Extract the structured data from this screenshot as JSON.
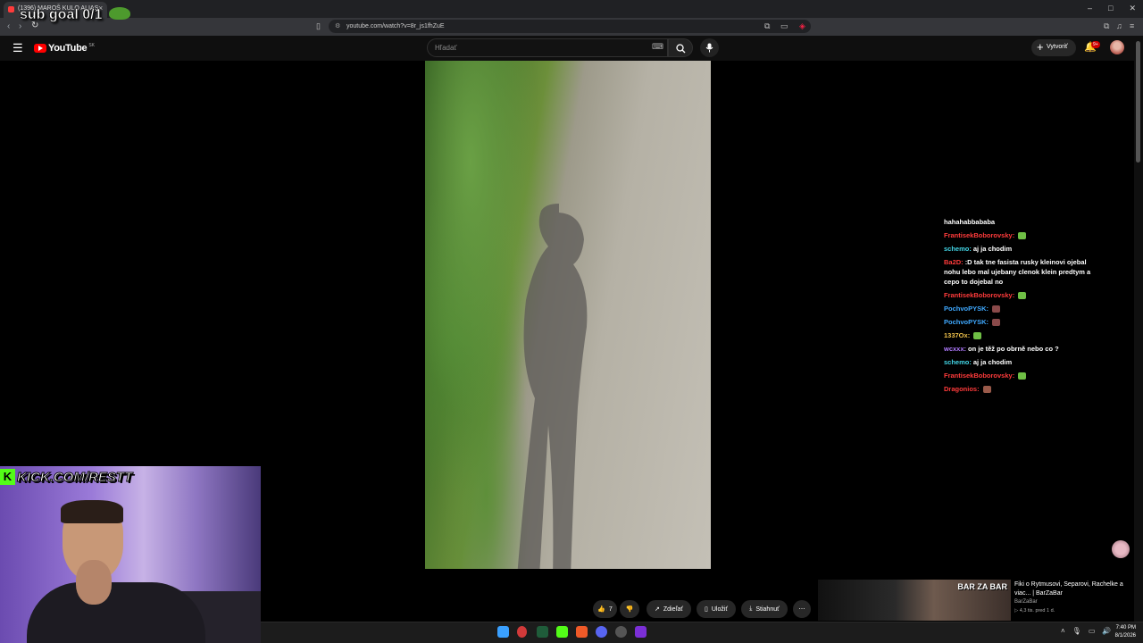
{
  "overlay": {
    "sub_goal": "sub goal 0/1"
  },
  "browser": {
    "tab_title": "(1396) MAROŠ KULO ALIAS",
    "tab_close": "×",
    "url": "youtube.com/watch?v=8r_js1fhZuE",
    "window_controls": [
      "–",
      "□",
      "✕"
    ]
  },
  "youtube": {
    "logo_text": "YouTube",
    "logo_region": "SK",
    "search_placeholder": "Hľadať",
    "create_label": "Vytvoriť",
    "notification_badge": "9+"
  },
  "chat": {
    "messages": [
      {
        "user": "hahahabbababa",
        "user_color": "#ffffff",
        "text": "",
        "emote": ""
      },
      {
        "user": "FrantisekBoborovsky:",
        "user_color": "#ff3b3b",
        "text": "",
        "emote": "#6fbf45"
      },
      {
        "user": "schemo:",
        "user_color": "#43d6e6",
        "text": "aj ja chodim",
        "emote": ""
      },
      {
        "user": "Ba2D:",
        "user_color": "#ff3b3b",
        "text": ":D tak tne fasista rusky kleinovi ojebal nohu lebo mal ujebany clenok klein predtym a cepo to dojebal no",
        "emote": ""
      },
      {
        "user": "FrantisekBoborovsky:",
        "user_color": "#ff3b3b",
        "text": "",
        "emote": "#6fbf45"
      },
      {
        "user": "PochvoPYSK:",
        "user_color": "#3fa9ff",
        "text": "",
        "emote": "#8a4a4a"
      },
      {
        "user": "PochvoPYSK:",
        "user_color": "#3fa9ff",
        "text": "",
        "emote": "#8a4a4a"
      },
      {
        "user": "1337Ox:",
        "user_color": "#f0c24b",
        "text": "",
        "emote": "#6fbf45"
      },
      {
        "user": "wcxxx:",
        "user_color": "#b07bff",
        "text": "on je těž po obrně nebo co ?",
        "emote": ""
      },
      {
        "user": "schemo:",
        "user_color": "#43d6e6",
        "text": "aj ja chodim",
        "emote": ""
      },
      {
        "user": "FrantisekBoborovsky:",
        "user_color": "#ff3b3b",
        "text": "",
        "emote": "#6fbf45"
      },
      {
        "user": "Dragonios:",
        "user_color": "#ff3b3b",
        "text": "",
        "emote": "#9a5a4a"
      }
    ]
  },
  "webcam": {
    "kick_text": "KICK.COM/RESTT",
    "kick_letter": "K"
  },
  "actions": {
    "like_count": "7",
    "share_label": "Zdieľať",
    "save_label": "Uložiť",
    "download_label": "Stiahnuť",
    "more_label": "⋯"
  },
  "recommended": {
    "title": "Fiki o Rytmusovi, Separovi, Rachelke a viac... | BarZaBar",
    "channel": "BarZaBar",
    "meta": "▷ 4,3 tis.   pred 1 d.",
    "thumb_logo": "BAR ZA BAR"
  },
  "taskbar": {
    "time": "7:40 PM",
    "date": "8/1/2026"
  },
  "colors": {
    "accent_red": "#ff0000",
    "kick_green": "#53fc18",
    "bg": "#0f0f0f"
  }
}
